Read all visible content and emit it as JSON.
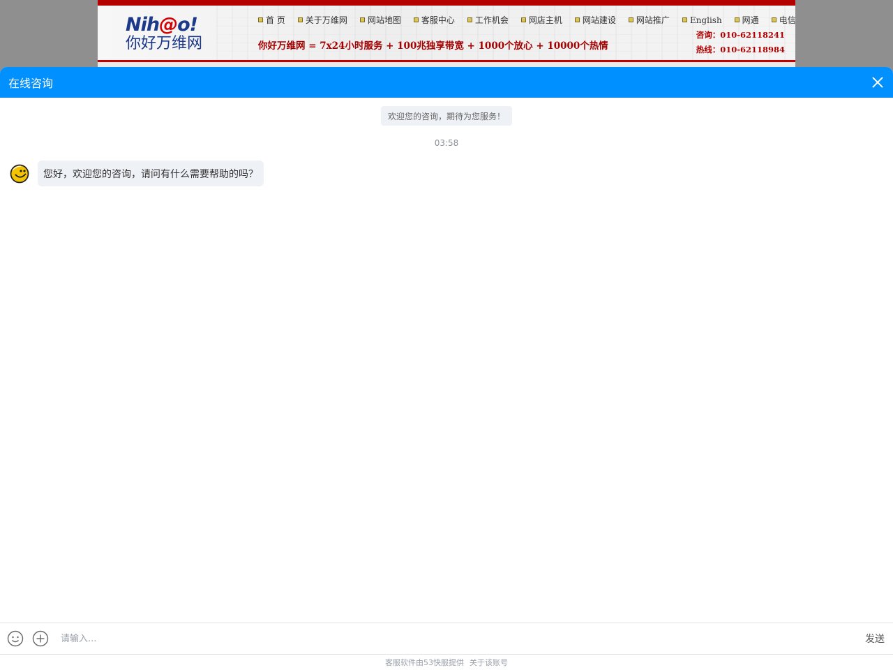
{
  "site": {
    "logo_text": "Nih@o!",
    "logo_cn": "你好万维网",
    "nav": [
      "首 页",
      "关于万维网",
      "网站地图",
      "客服中心",
      "工作机会",
      "网店主机",
      "网站建设",
      "网站推广",
      "English",
      "网通",
      "电信"
    ],
    "slogan": "你好万维网 = 7x24小时服务 + 100兆独享带宽 + 1000个放心 + 10000个热情",
    "consult": "咨询：010-62118241",
    "hotline": "热线：010-62118984"
  },
  "chat": {
    "title": "在线咨询",
    "system_message": "欢迎您的咨询，期待为您服务！",
    "timestamp": "03:58",
    "agent_message": "您好，欢迎您的咨询，请问有什么需要帮助的吗？",
    "input_placeholder": "请输入...",
    "send_label": "发送",
    "footer_provider": "客服软件由53快服提供",
    "footer_about": "关于该账号",
    "accent_color": "#0090ff"
  },
  "icons": {
    "close": "close-icon",
    "avatar": "smiley-avatar-icon",
    "emoji": "emoji-icon",
    "plus": "plus-icon"
  }
}
